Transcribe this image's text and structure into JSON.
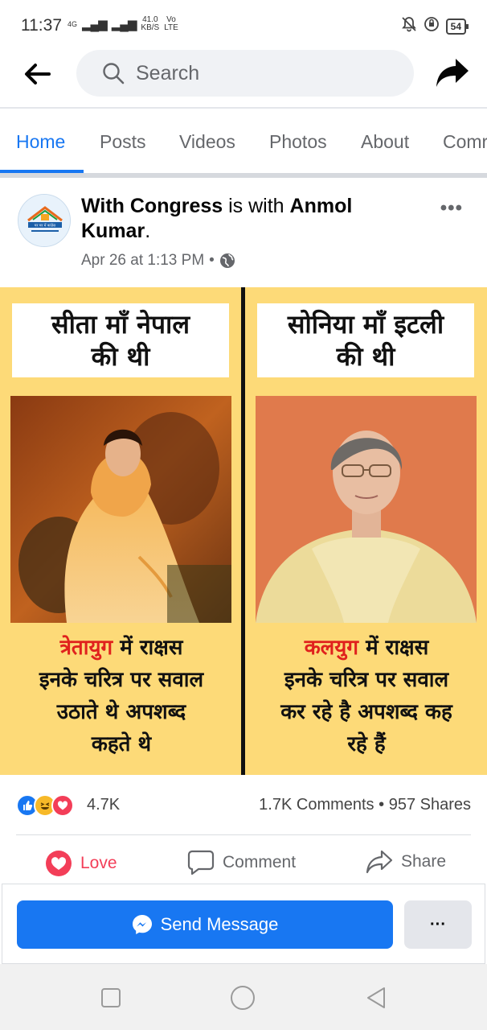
{
  "status_bar": {
    "time": "11:37",
    "network_label": "4G",
    "speed_value": "41.0",
    "speed_unit": "KB/S",
    "volte_label": "Vo",
    "lte_label": "LTE",
    "battery": "54"
  },
  "top_nav": {
    "search_placeholder": "Search"
  },
  "tabs": [
    {
      "label": "Home"
    },
    {
      "label": "Posts"
    },
    {
      "label": "Videos"
    },
    {
      "label": "Photos"
    },
    {
      "label": "About"
    },
    {
      "label": "Comr"
    }
  ],
  "post": {
    "page_name": "With Congress",
    "with_text": " is with ",
    "tagged_name": "Anmol Kumar",
    "period": ".",
    "timestamp": "Apr 26 at 1:13 PM",
    "separator": "•",
    "more_label": "•••",
    "avatar_text": "घर घर में कांग्रेस"
  },
  "image": {
    "left": {
      "headline_line1": "सीता माँ नेपाल",
      "headline_line2": "की थी",
      "era": "त्रेतायुग",
      "caption_rest_line1": " में राक्षस",
      "caption_line2": "इनके चरित्र पर सवाल",
      "caption_line3": "उठाते थे अपशब्द",
      "caption_line4": "कहते थे"
    },
    "right": {
      "headline_line1": "सोनिया माँ इटली",
      "headline_line2": "की थी",
      "era": "कलयुग",
      "caption_rest_line1": " में राक्षस",
      "caption_line2": "इनके चरित्र पर सवाल",
      "caption_line3": "कर रहे है अपशब्द कह",
      "caption_line4": "रहे हैं"
    }
  },
  "reactions": {
    "count": "4.7K",
    "comments": "1.7K Comments",
    "dot": "•",
    "shares": "957 Shares"
  },
  "actions": {
    "love": "Love",
    "comment": "Comment",
    "share": "Share"
  },
  "message_bar": {
    "send_label": "Send Message",
    "more_label": "···"
  },
  "colors": {
    "accent": "#1877f2",
    "love": "#f33e58",
    "image_bg": "#fdda78",
    "era_red": "#e0211d"
  }
}
